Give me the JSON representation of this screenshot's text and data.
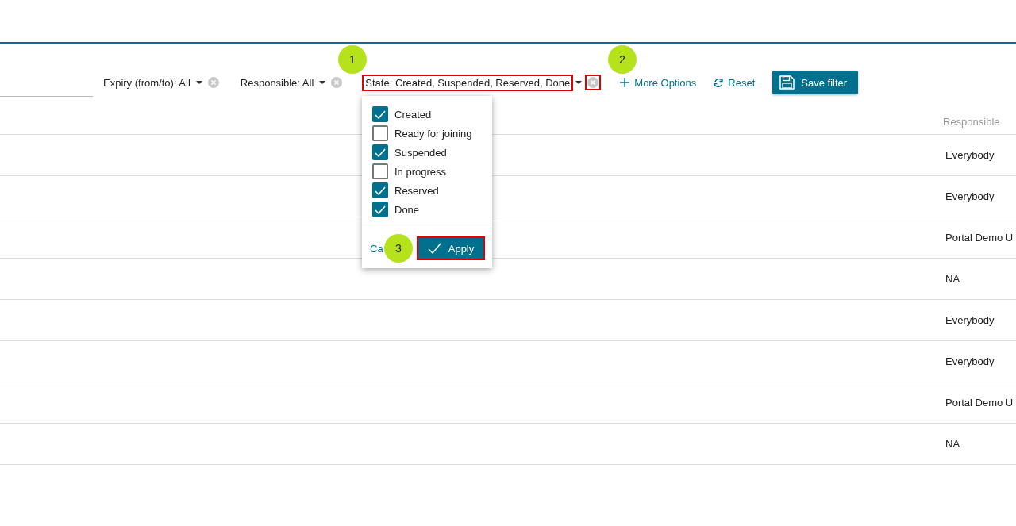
{
  "filters": [
    {
      "label": "Expiry (from/to): All",
      "highlighted": false,
      "clear_highlighted": false
    },
    {
      "label": "Responsible: All",
      "highlighted": false,
      "clear_highlighted": false
    },
    {
      "label": "State: Created, Suspended, Reserved, Done",
      "highlighted": true,
      "clear_highlighted": true
    }
  ],
  "more_options": "More Options",
  "reset": "Reset",
  "save_filter": "Save filter",
  "state_dropdown": {
    "options": [
      {
        "label": "Created",
        "checked": true
      },
      {
        "label": "Ready for joining",
        "checked": false
      },
      {
        "label": "Suspended",
        "checked": true
      },
      {
        "label": "In progress",
        "checked": false
      },
      {
        "label": "Reserved",
        "checked": true
      },
      {
        "label": "Done",
        "checked": true
      }
    ],
    "cancel": "Ca",
    "apply": {
      "label": "Apply",
      "highlighted": true
    }
  },
  "table": {
    "columns": [
      "Responsible"
    ],
    "rows": [
      "Everybody",
      "Everybody",
      "Portal Demo U",
      "NA",
      "Everybody",
      "Everybody",
      "Portal Demo U",
      "NA"
    ]
  },
  "callouts": [
    "1",
    "2",
    "3"
  ]
}
